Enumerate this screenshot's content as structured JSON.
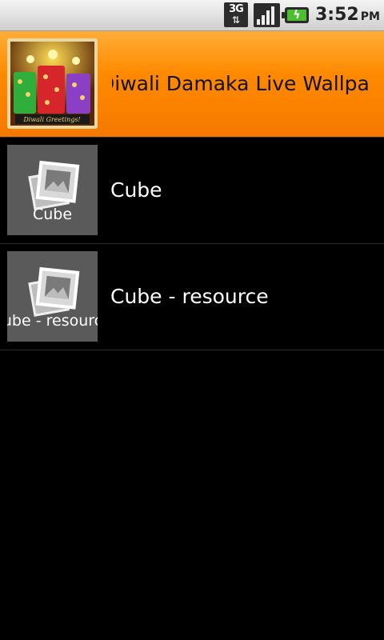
{
  "status_bar": {
    "network": "3G",
    "network_activity": "⇅",
    "signal_icon": "signal-bars-icon",
    "battery_icon": "battery-charging-icon",
    "time": "3:52",
    "ampm": "PM"
  },
  "list": {
    "items": [
      {
        "label": "Diwali Damaka Live Wallpa",
        "selected": true,
        "thumbnail_caption": "Diwali Greetings!"
      },
      {
        "label": "Cube",
        "selected": false,
        "thumbnail_caption": "Cube"
      },
      {
        "label": "Cube - resource",
        "selected": false,
        "thumbnail_caption": "ube - resourc"
      }
    ]
  },
  "colors": {
    "selected_row": "#ff8a00",
    "background": "#000000",
    "thumbnail_placeholder": "#5a5a5a"
  }
}
